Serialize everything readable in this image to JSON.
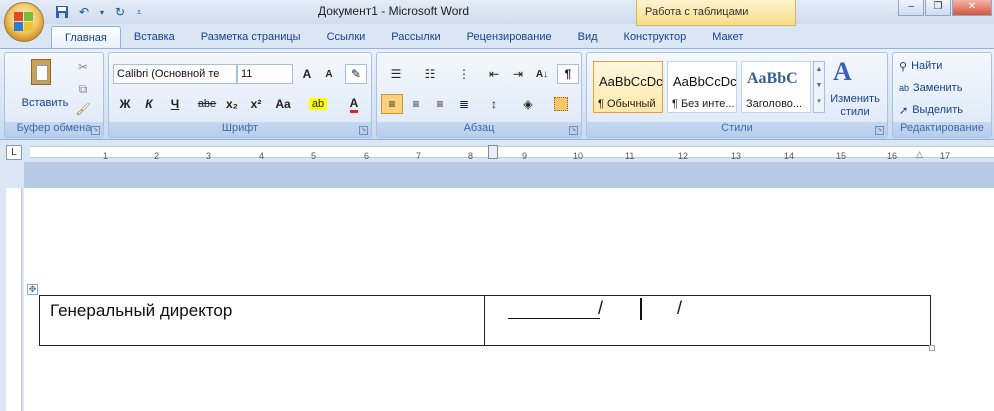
{
  "window": {
    "title": "Документ1 - Microsoft Word",
    "context_tab": "Работа с таблицами"
  },
  "tabs": [
    "Главная",
    "Вставка",
    "Разметка страницы",
    "Ссылки",
    "Рассылки",
    "Рецензирование",
    "Вид",
    "Конструктор",
    "Макет"
  ],
  "clipboard": {
    "paste_label": "Вставить",
    "group_label": "Буфер обмена"
  },
  "font": {
    "name": "Calibri (Основной те",
    "size": "11",
    "group_label": "Шрифт",
    "grow": "A",
    "shrink": "A",
    "bold": "Ж",
    "italic": "К",
    "underline": "Ч",
    "strike": "abe",
    "sub": "x₂",
    "sup": "x²",
    "case": "Aa"
  },
  "paragraph": {
    "group_label": "Абзац",
    "pilcrow": "¶"
  },
  "styles": {
    "group_label": "Стили",
    "items": [
      {
        "preview": "AaBbCcDc",
        "name": "¶ Обычный"
      },
      {
        "preview": "AaBbCcDc",
        "name": "¶ Без инте..."
      },
      {
        "preview": "AaBbC",
        "name": "Заголово..."
      }
    ],
    "change_label": "Изменить стили"
  },
  "editing": {
    "group_label": "Редактирование",
    "find": "Найти",
    "replace": "Заменить",
    "select": "Выделить"
  },
  "ruler": {
    "numbers": [
      "1",
      "2",
      "3",
      "4",
      "5",
      "6",
      "7",
      "8",
      "9",
      "10",
      "11",
      "12",
      "13",
      "14",
      "15",
      "16",
      "17"
    ]
  },
  "document": {
    "cell1_text": "Генеральный директор",
    "slash1": "/",
    "slash2": "/"
  }
}
